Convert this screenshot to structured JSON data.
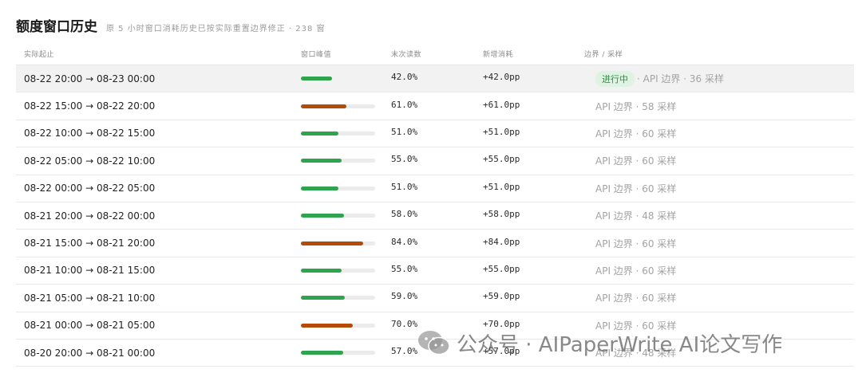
{
  "header": {
    "title": "额度窗口历史",
    "subtitle": "原 5 小时窗口消耗历史已按实际重置边界修正 · 238 窗"
  },
  "table": {
    "columns": [
      "实际起止",
      "窗口峰值",
      "末次读数",
      "新增消耗",
      "边界 / 采样"
    ],
    "colors": {
      "green": "#2ea44f",
      "orange": "#b54b08"
    },
    "rows": [
      {
        "range": "08-22 20:00 → 08-23 00:00",
        "peak": 0.42,
        "color": "#2ea44f",
        "read": "42.0%",
        "added": "+42.0pp",
        "badge": "进行中",
        "source": "· API 边界 · 36 采样",
        "active": true
      },
      {
        "range": "08-22 15:00 → 08-22 20:00",
        "peak": 0.61,
        "color": "#b54b08",
        "read": "61.0%",
        "added": "+61.0pp",
        "badge": "",
        "source": "API 边界 · 58 采样",
        "active": false
      },
      {
        "range": "08-22 10:00 → 08-22 15:00",
        "peak": 0.51,
        "color": "#2ea44f",
        "read": "51.0%",
        "added": "+51.0pp",
        "badge": "",
        "source": "API 边界 · 60 采样",
        "active": false
      },
      {
        "range": "08-22 05:00 → 08-22 10:00",
        "peak": 0.55,
        "color": "#2ea44f",
        "read": "55.0%",
        "added": "+55.0pp",
        "badge": "",
        "source": "API 边界 · 60 采样",
        "active": false
      },
      {
        "range": "08-22 00:00 → 08-22 05:00",
        "peak": 0.51,
        "color": "#2ea44f",
        "read": "51.0%",
        "added": "+51.0pp",
        "badge": "",
        "source": "API 边界 · 60 采样",
        "active": false
      },
      {
        "range": "08-21 20:00 → 08-22 00:00",
        "peak": 0.58,
        "color": "#2ea44f",
        "read": "58.0%",
        "added": "+58.0pp",
        "badge": "",
        "source": "API 边界 · 48 采样",
        "active": false
      },
      {
        "range": "08-21 15:00 → 08-21 20:00",
        "peak": 0.84,
        "color": "#b54b08",
        "read": "84.0%",
        "added": "+84.0pp",
        "badge": "",
        "source": "API 边界 · 60 采样",
        "active": false
      },
      {
        "range": "08-21 10:00 → 08-21 15:00",
        "peak": 0.55,
        "color": "#2ea44f",
        "read": "55.0%",
        "added": "+55.0pp",
        "badge": "",
        "source": "API 边界 · 60 采样",
        "active": false
      },
      {
        "range": "08-21 05:00 → 08-21 10:00",
        "peak": 0.59,
        "color": "#2ea44f",
        "read": "59.0%",
        "added": "+59.0pp",
        "badge": "",
        "source": "API 边界 · 60 采样",
        "active": false
      },
      {
        "range": "08-21 00:00 → 08-21 05:00",
        "peak": 0.7,
        "color": "#b54b08",
        "read": "70.0%",
        "added": "+70.0pp",
        "badge": "",
        "source": "API 边界 · 60 采样",
        "active": false
      },
      {
        "range": "08-20 20:00 → 08-21 00:00",
        "peak": 0.57,
        "color": "#2ea44f",
        "read": "57.0%",
        "added": "+57.0pp",
        "badge": "",
        "source": "API 边界 · 48 采样",
        "active": false
      }
    ]
  },
  "watermark": {
    "icon": "wechat-icon",
    "text": "公众号 · AIPaperWrite AI论文写作"
  }
}
